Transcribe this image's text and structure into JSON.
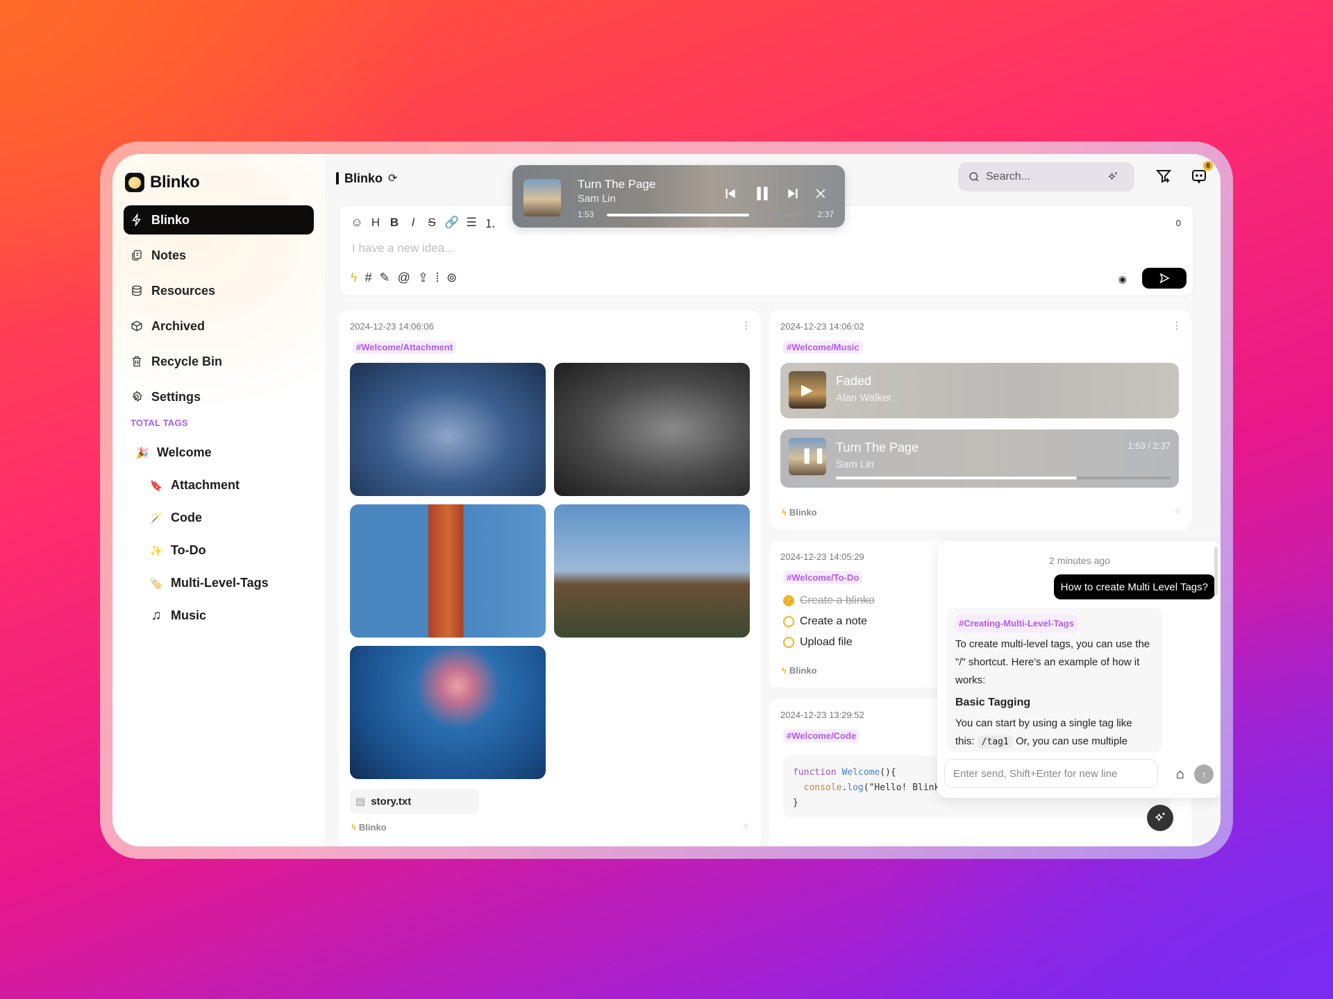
{
  "app": {
    "name": "Blinko"
  },
  "sidebar": {
    "items": [
      {
        "label": "Blinko",
        "icon": "bolt-icon",
        "active": true
      },
      {
        "label": "Notes",
        "icon": "notes-icon"
      },
      {
        "label": "Resources",
        "icon": "database-icon"
      },
      {
        "label": "Archived",
        "icon": "box-icon"
      },
      {
        "label": "Recycle Bin",
        "icon": "trash-icon"
      },
      {
        "label": "Settings",
        "icon": "gear-icon"
      }
    ],
    "tags_title": "TOTAL TAGS",
    "tags": [
      {
        "label": "Welcome",
        "emoji": "🎉",
        "level": 0
      },
      {
        "label": "Attachment",
        "emoji": "🔖",
        "level": 1
      },
      {
        "label": "Code",
        "emoji": "🪄",
        "level": 1
      },
      {
        "label": "To-Do",
        "emoji": "✨",
        "level": 1
      },
      {
        "label": "Multi-Level-Tags",
        "emoji": "🏷️",
        "level": 1
      },
      {
        "label": "Music",
        "emoji": "♫",
        "level": 1
      }
    ]
  },
  "header": {
    "title": "Blinko",
    "search_placeholder": "Search...",
    "notification_count": "8"
  },
  "editor": {
    "placeholder": "I have a new idea...",
    "char_count": "0",
    "toolbar": [
      "☺",
      "H",
      "B",
      "I",
      "S",
      "🔗",
      "☰",
      "⒈"
    ]
  },
  "player": {
    "title": "Turn The Page",
    "artist": "Sam Lin",
    "current": "1:53",
    "total": "2:37",
    "progress": 0.72
  },
  "cards": {
    "attachment": {
      "timestamp": "2024-12-23 14:06:06",
      "tag": "#Welcome/Attachment",
      "file": "story.txt",
      "footer": "Blinko"
    },
    "music": {
      "timestamp": "2024-12-23 14:06:02",
      "tag": "#Welcome/Music",
      "tracks": [
        {
          "title": "Faded",
          "artist": "Alan Walker",
          "state": "paused"
        },
        {
          "title": "Turn The Page",
          "artist": "Sam Lin",
          "state": "playing",
          "time": "1:53 / 2:37",
          "progress": 0.72
        }
      ],
      "footer": "Blinko"
    },
    "todo": {
      "timestamp": "2024-12-23 14:05:29",
      "tag": "#Welcome/To-Do",
      "items": [
        {
          "label": "Create a blinko",
          "done": true
        },
        {
          "label": "Create a note",
          "done": false
        },
        {
          "label": "Upload file",
          "done": false
        }
      ],
      "footer": "Blinko"
    },
    "code": {
      "timestamp": "2024-12-23 13:29:52",
      "tag": "#Welcome/Code",
      "lines": [
        "function Welcome(){",
        "  console.log(\"Hello! Blinko\");",
        "}"
      ]
    }
  },
  "chat": {
    "time": "2 minutes ago",
    "question": "How to create Multi Level Tags?",
    "answer_tag": "#Creating-Multi-Level-Tags",
    "answer_p1": "To create multi-level tags, you can use the \"/\" shortcut. Here's an example of how it works:",
    "answer_heading": "Basic Tagging",
    "answer_p2_a": "You can start by using a single tag like this: ",
    "answer_code": "/tag1",
    "answer_p2_b": " Or, you can use multiple",
    "input_placeholder": "Enter send, Shift+Enter for new line"
  }
}
